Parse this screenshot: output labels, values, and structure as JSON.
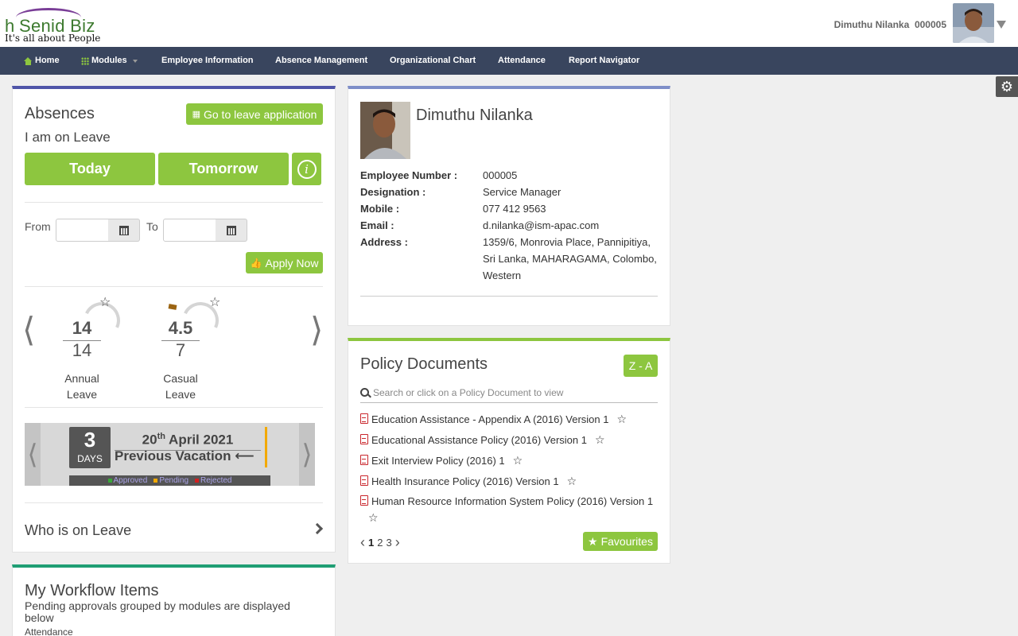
{
  "header": {
    "logo_h": "h",
    "logo_text": "Senid Biz",
    "logo_tagline": "It's all about People",
    "user_name": "Dimuthu Nilanka",
    "user_id": "000005"
  },
  "nav": {
    "items": [
      {
        "label": "Home",
        "icon": "home-icon"
      },
      {
        "label": "Modules",
        "icon": "grid-icon"
      },
      {
        "label": "Employee Information"
      },
      {
        "label": "Absence Management"
      },
      {
        "label": "Organizational Chart"
      },
      {
        "label": "Attendance"
      },
      {
        "label": "Report Navigator"
      }
    ]
  },
  "settings_icon": "gear-icon",
  "absences": {
    "title": "Absences",
    "subtitle": "I am on Leave",
    "leave_app_button": "Go to leave application",
    "today_button": "Today",
    "tomorrow_button": "Tomorrow",
    "info_button": "i",
    "from_label": "From",
    "to_label": "To",
    "from_value": "",
    "to_value": "",
    "apply_button": "Apply Now",
    "leave_types": [
      {
        "available": "14",
        "total": "14",
        "name_line1": "Annual",
        "name_line2": "Leave"
      },
      {
        "available": "4.5",
        "total": "7",
        "name_line1": "Casual",
        "name_line2": "Leave"
      }
    ],
    "vacation": {
      "days_number": "3",
      "days_label": "DAYS",
      "date_day": "20",
      "date_suffix": "th",
      "date_rest": " April 2021",
      "label": "Previous Vacation",
      "legend": [
        "Approved",
        "Pending",
        "Rejected"
      ],
      "legend_colors": [
        "#3aa83a",
        "#f2a900",
        "#d21f1f"
      ]
    },
    "who_on_leave": "Who is on Leave"
  },
  "profile": {
    "name": "Dimuthu Nilanka",
    "rows": [
      {
        "key": "Employee Number :",
        "value": "000005"
      },
      {
        "key": "Designation :",
        "value": "Service Manager"
      },
      {
        "key": "Mobile :",
        "value": "077 412 9563"
      },
      {
        "key": "Email :",
        "value": "d.nilanka@ism-apac.com"
      },
      {
        "key": "Address :",
        "value": "1359/6, Monrovia Place, Pannipitiya, Sri Lanka, MAHARAGAMA, Colombo, Western"
      }
    ]
  },
  "policy": {
    "title": "Policy Documents",
    "sort_button": "Z - A",
    "search_placeholder": "Search or click on a Policy Document to view",
    "documents": [
      "Education Assistance - Appendix A (2016) Version 1",
      "Educational Assistance Policy (2016) Version 1",
      "Exit Interview Policy (2016) 1",
      "Health Insurance Policy (2016) Version 1",
      "Human Resource Information System Policy (2016) Version 1"
    ],
    "pages": [
      "1",
      "2",
      "3"
    ],
    "favourites_button": "Favourites"
  },
  "workflow": {
    "title": "My Workflow Items",
    "subtitle": "Pending approvals grouped by modules are displayed below",
    "section": "Attendance"
  },
  "colors": {
    "accent_green": "#8dc63f",
    "nav_bg": "#39455e",
    "absences_border": "#4f55a8",
    "policy_border": "#8dc63f",
    "workflow_border": "#1f9e74"
  }
}
